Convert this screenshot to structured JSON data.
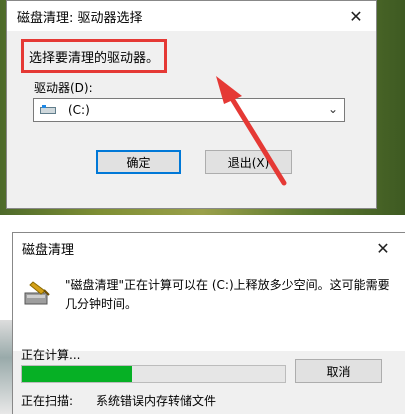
{
  "select_dialog": {
    "title": "磁盘清理: 驱动器选择",
    "prompt": "选择要清理的驱动器。",
    "drive_label": "驱动器(D):",
    "drive_value": "(C:)",
    "ok_label": "确定",
    "exit_label": "退出(X)"
  },
  "progress_dialog": {
    "title": "磁盘清理",
    "message": "\"磁盘清理\"正在计算可以在 (C:)上释放多少空间。这可能需要几分钟时间。",
    "calc_label": "正在计算...",
    "progress_fraction": 0.42,
    "cancel_label": "取消",
    "scan_label": "正在扫描:",
    "scan_item": "系统错误内存转储文件"
  },
  "colors": {
    "highlight_red": "#e53935",
    "progress_green": "#06b025",
    "focus_blue": "#0078d7"
  }
}
